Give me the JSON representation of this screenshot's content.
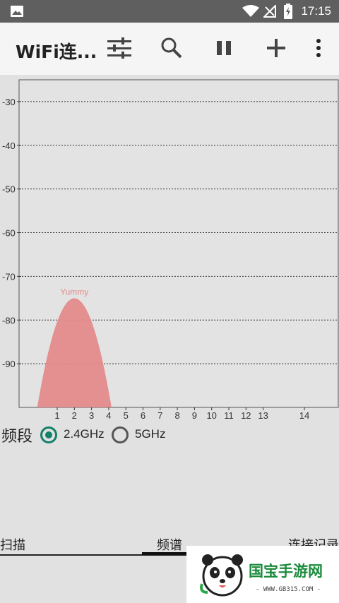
{
  "status_bar": {
    "time": "17:15"
  },
  "toolbar": {
    "title": "WiFi连..."
  },
  "chart_data": {
    "type": "area",
    "y_ticks": [
      "-30",
      "-40",
      "-50",
      "-60",
      "-70",
      "-80",
      "-90"
    ],
    "x_ticks": [
      "1",
      "2",
      "3",
      "4",
      "5",
      "6",
      "7",
      "8",
      "9",
      "10",
      "11",
      "12",
      "13",
      "14"
    ],
    "series": [
      {
        "name": "Yummy",
        "channel": 2,
        "signal": -75,
        "color": "#e48b8b"
      }
    ]
  },
  "band": {
    "label": "频段",
    "options": [
      {
        "label": "2.4GHz",
        "selected": true
      },
      {
        "label": "5GHz",
        "selected": false
      }
    ]
  },
  "tabs": [
    {
      "label": "扫描"
    },
    {
      "label": "频谱",
      "active": true
    },
    {
      "label": "连接记录"
    }
  ],
  "watermark": {
    "brand": "国宝手游网",
    "url": "- WWW.GB315.COM -"
  }
}
